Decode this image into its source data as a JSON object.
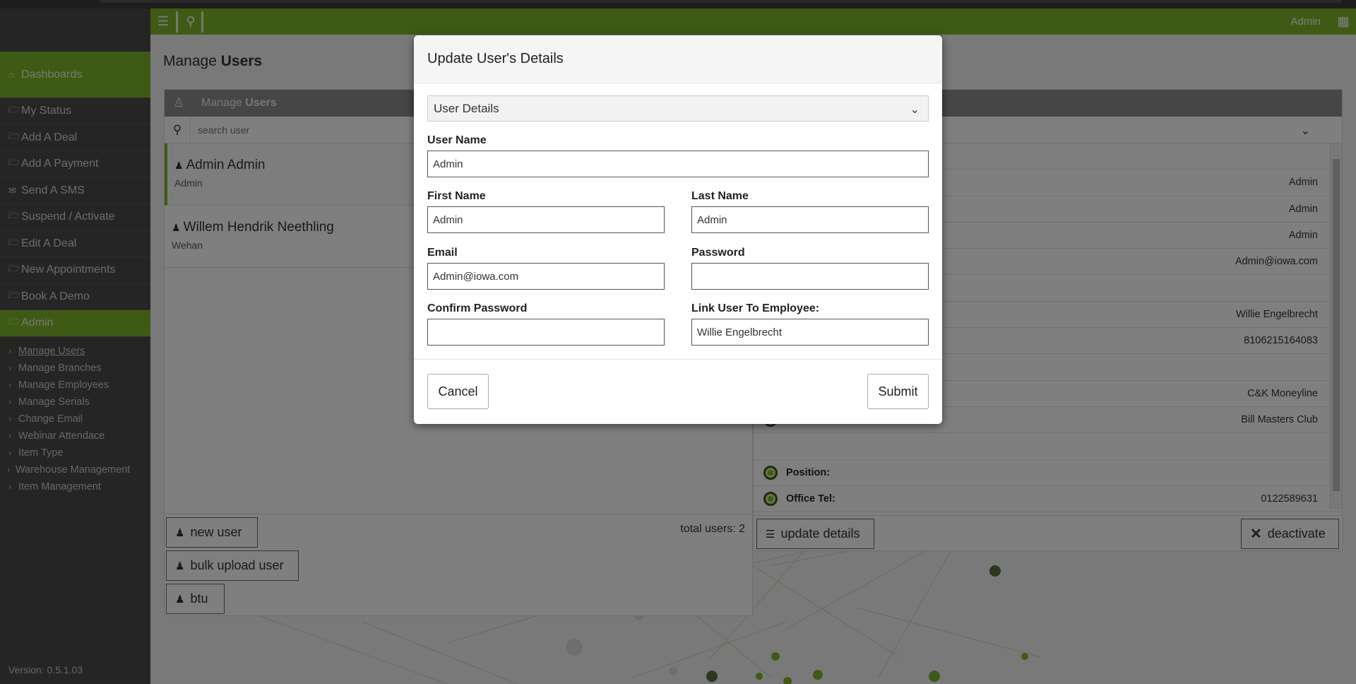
{
  "topbar": {
    "user": "Admin"
  },
  "sidebar": {
    "dashboard_label": "Dashboards",
    "items": [
      {
        "label": "My Status"
      },
      {
        "label": "Add A Deal"
      },
      {
        "label": "Add A Payment"
      },
      {
        "label": "Send A SMS"
      },
      {
        "label": "Suspend / Activate"
      },
      {
        "label": "Edit A Deal"
      },
      {
        "label": "New Appointments"
      },
      {
        "label": "Book A Demo"
      },
      {
        "label": "Admin"
      }
    ],
    "subitems": [
      {
        "label": "Manage Users"
      },
      {
        "label": "Manage Branches"
      },
      {
        "label": "Manage Employees"
      },
      {
        "label": "Manage Serials"
      },
      {
        "label": "Change Email"
      },
      {
        "label": "Webinar Attendace"
      },
      {
        "label": "Item Type"
      },
      {
        "label": "Warehouse Management"
      },
      {
        "label": "Item Management"
      }
    ],
    "version": "Version: 0.5.1.03"
  },
  "page": {
    "title_prefix": "Manage",
    "title_bold": "Users"
  },
  "users_panel": {
    "head_prefix": "Manage",
    "head_bold": "Users",
    "search_placeholder": "search user",
    "users": [
      {
        "name": "Admin Admin",
        "sub": "Admin"
      },
      {
        "name": "Willem Hendrik Neethling",
        "sub": "Wehan"
      }
    ],
    "total": "total users: 2",
    "buttons": {
      "new_user": "new user",
      "bulk_upload": "bulk upload user",
      "btu": "btu"
    }
  },
  "details_panel": {
    "rows": [
      {
        "value": ""
      },
      {
        "value": "Admin"
      },
      {
        "value": "Admin"
      },
      {
        "value": "Admin"
      },
      {
        "value": "Admin@iowa.com"
      },
      {
        "value": ""
      },
      {
        "value": "Willie Engelbrecht"
      },
      {
        "value": "8106215164083"
      },
      {
        "value": ""
      },
      {
        "value": "C&K Moneyline"
      },
      {
        "value": "Bill Masters Club"
      },
      {
        "value": ""
      },
      {
        "label": "Position:",
        "value": ""
      },
      {
        "label": "Office Tel:",
        "value": "0122589631"
      }
    ],
    "buttons": {
      "update": "update details",
      "deactivate": "deactivate"
    }
  },
  "modal": {
    "title": "Update User's Details",
    "section": "User Details",
    "fields": {
      "username_label": "User Name",
      "username": "Admin",
      "first_label": "First Name",
      "first": "Admin",
      "last_label": "Last Name",
      "last": "Admin",
      "email_label": "Email",
      "email": "Admin@iowa.com",
      "password_label": "Password",
      "password": "",
      "confirm_label": "Confirm Password",
      "confirm": "",
      "link_label": "Link User To Employee:",
      "link": "Willie Engelbrecht"
    },
    "cancel": "Cancel",
    "submit": "Submit"
  },
  "colors": {
    "accent": "#7fb52a",
    "sidebar": "#4a4a4a"
  }
}
